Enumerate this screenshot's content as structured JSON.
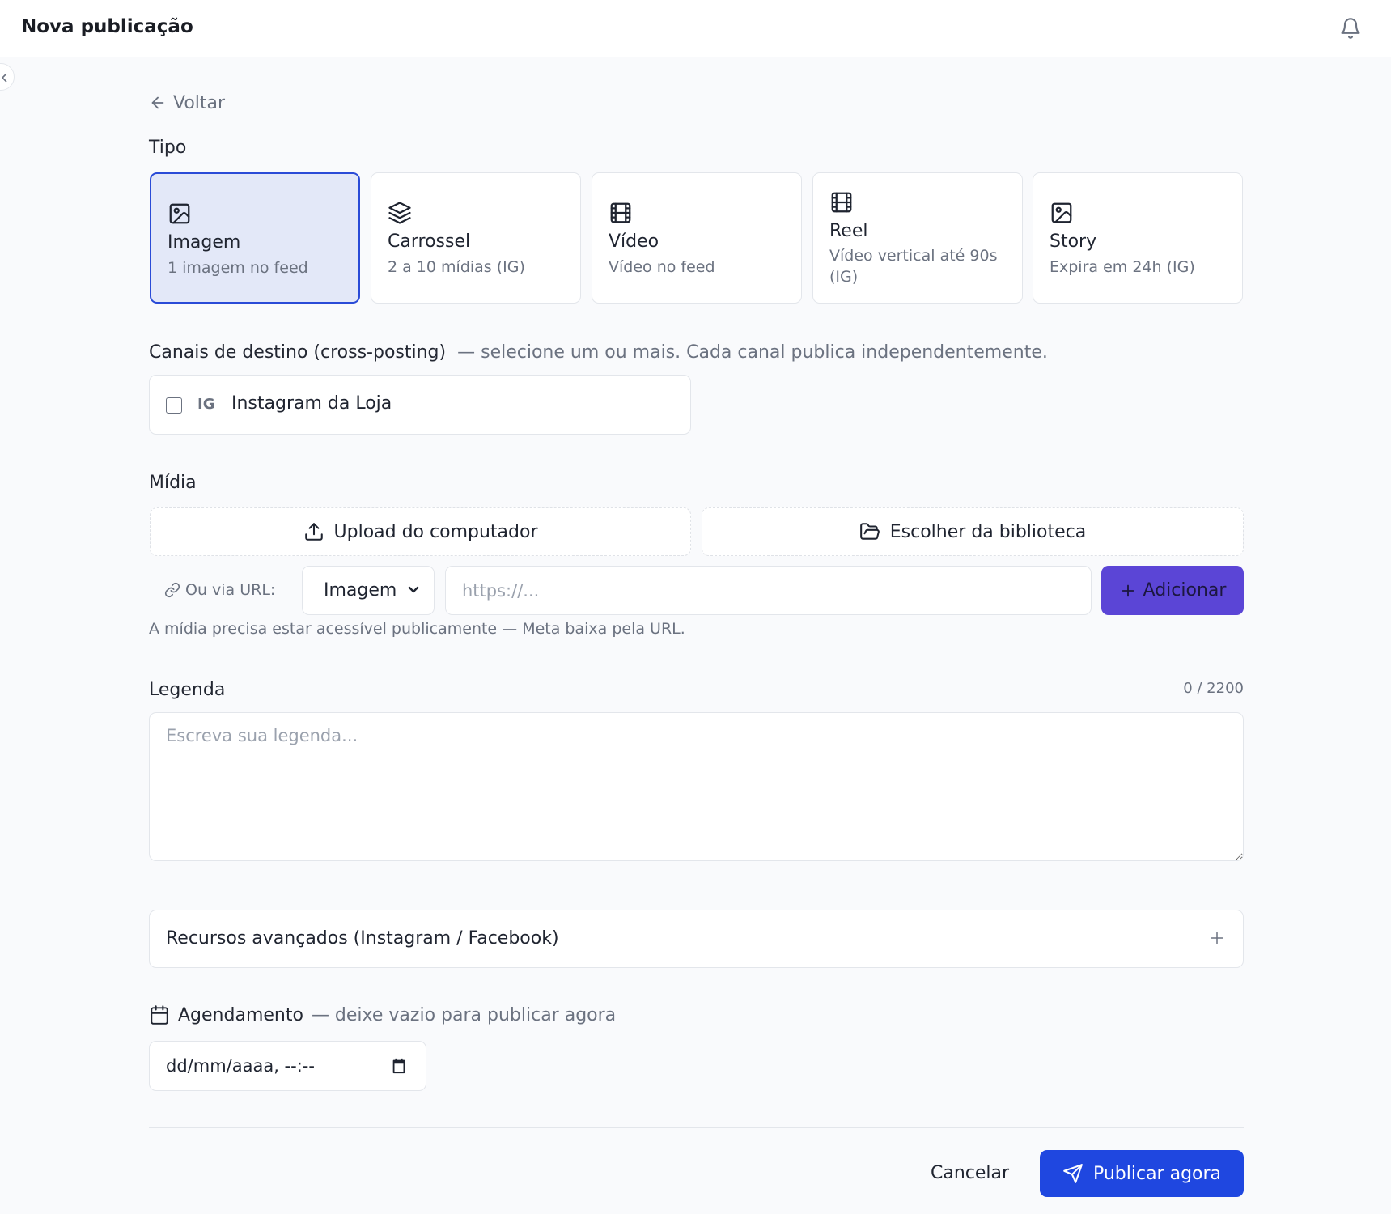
{
  "header": {
    "title": "Nova publicação"
  },
  "back_label": "Voltar",
  "type_section": {
    "label": "Tipo",
    "selected": "Imagem",
    "options": [
      {
        "name": "Imagem",
        "description": "1 imagem no feed",
        "icon": "image-icon"
      },
      {
        "name": "Carrossel",
        "description": "2 a 10 mídias (IG)",
        "icon": "layers-icon"
      },
      {
        "name": "Vídeo",
        "description": "Vídeo no feed",
        "icon": "film-icon"
      },
      {
        "name": "Reel",
        "description": "Vídeo vertical até 90s (IG)",
        "icon": "film-icon"
      },
      {
        "name": "Story",
        "description": "Expira em 24h (IG)",
        "icon": "image-icon"
      }
    ]
  },
  "channels": {
    "label": "Canais de destino (cross-posting)",
    "hint": "— selecione um ou mais. Cada canal publica independentemente.",
    "items": [
      {
        "tag": "IG",
        "name": "Instagram da Loja",
        "checked": false
      }
    ]
  },
  "media": {
    "label": "Mídia",
    "upload_label": "Upload do computador",
    "library_label": "Escolher da biblioteca",
    "url_label": "Ou via URL:",
    "type_select_value": "Imagem",
    "url_placeholder": "https://...",
    "add_label": "Adicionar",
    "hint": "A mídia precisa estar acessível publicamente — Meta baixa pela URL."
  },
  "caption": {
    "label": "Legenda",
    "counter": "0 / 2200",
    "placeholder": "Escreva sua legenda..."
  },
  "advanced": {
    "label": "Recursos avançados (Instagram / Facebook)"
  },
  "schedule": {
    "label": "Agendamento",
    "hint": "— deixe vazio para publicar agora",
    "value": "dd/mm/aaaa, --:--"
  },
  "actions": {
    "cancel_label": "Cancelar",
    "publish_label": "Publicar agora"
  },
  "colors": {
    "primary": "#1f47e0",
    "accent": "#5b45d6",
    "selected_bg": "#e3e8f8"
  }
}
